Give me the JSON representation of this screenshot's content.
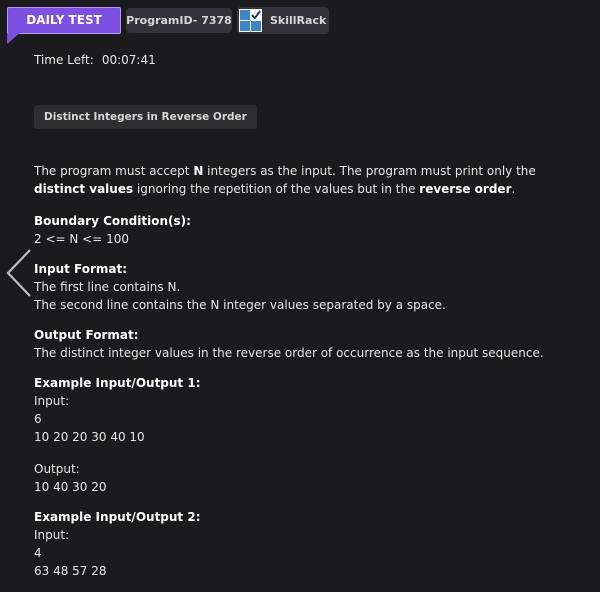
{
  "header": {
    "daily_test_label": "DAILY TEST",
    "program_id_label": "ProgramID- 7378",
    "brand_label": "SkillRack"
  },
  "timer": {
    "label": "Time Left:",
    "value": "00:07:41"
  },
  "problem": {
    "title": "Distinct Integers in Reverse Order",
    "description_parts": [
      "The program must accept ",
      "N",
      " integers as the input. The program must print only the ",
      "distinct values",
      " ignoring the repetition of the values but in the ",
      "reverse order",
      "."
    ],
    "boundary_heading": "Boundary Condition(s):",
    "boundary_text": "2 <= N <= 100",
    "input_format_heading": "Input Format:",
    "input_format_lines": [
      "The first line contains N.",
      "The second line contains the N integer values separated by a space."
    ],
    "output_format_heading": "Output Format:",
    "output_format_text": "The distinct integer values in the reverse order of occurrence as the input sequence.",
    "examples": [
      {
        "heading": "Example Input/Output 1:",
        "input_label": "Input:",
        "input_lines": [
          "6",
          "10 20 20 30 40 10"
        ],
        "output_label": "Output:",
        "output_lines": [
          "10 40 30 20"
        ]
      },
      {
        "heading": "Example Input/Output 2:",
        "input_label": "Input:",
        "input_lines": [
          "4",
          "63 48 57 28"
        ]
      }
    ]
  },
  "colors": {
    "background": "#1b1b1d",
    "accent": "#7c4fe0",
    "chip": "#343438"
  },
  "icons": {
    "back": "chevron-left-icon",
    "logo": "skillrack-logo-icon"
  }
}
